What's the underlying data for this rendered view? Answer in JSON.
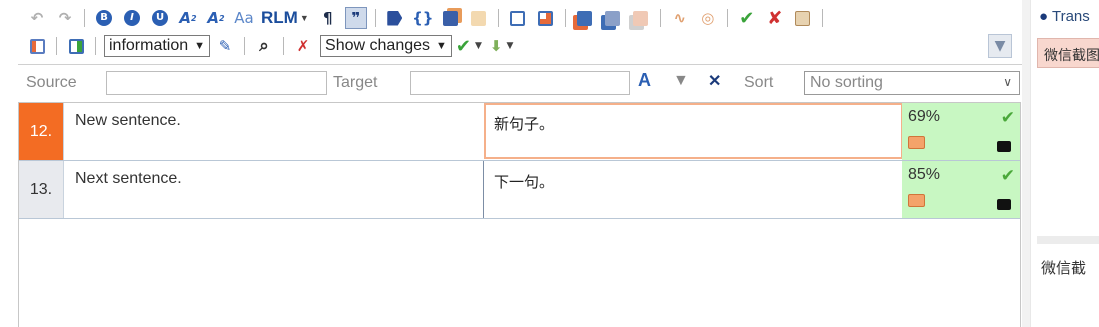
{
  "toolbar": {
    "rlm_label": "RLM",
    "status_select": "information",
    "changes_select": "Show changes"
  },
  "filter": {
    "source_label": "Source",
    "source_value": "",
    "target_label": "Target",
    "target_value": "",
    "sort_label": "Sort",
    "sort_value": "No sorting"
  },
  "rows": [
    {
      "num": "12.",
      "source": "New sentence.",
      "target": "新句子。",
      "match": "69%",
      "active": true
    },
    {
      "num": "13.",
      "source": "Next sentence.",
      "target": "下一句。",
      "match": "85%",
      "active": false
    }
  ],
  "right_panel": {
    "title": "Trans",
    "chip": "微信截图",
    "preview": "微信截"
  },
  "colors": {
    "active_row": "#f36c23",
    "match_bg": "#c8f7c2",
    "accent_blue": "#1b4d9c"
  }
}
